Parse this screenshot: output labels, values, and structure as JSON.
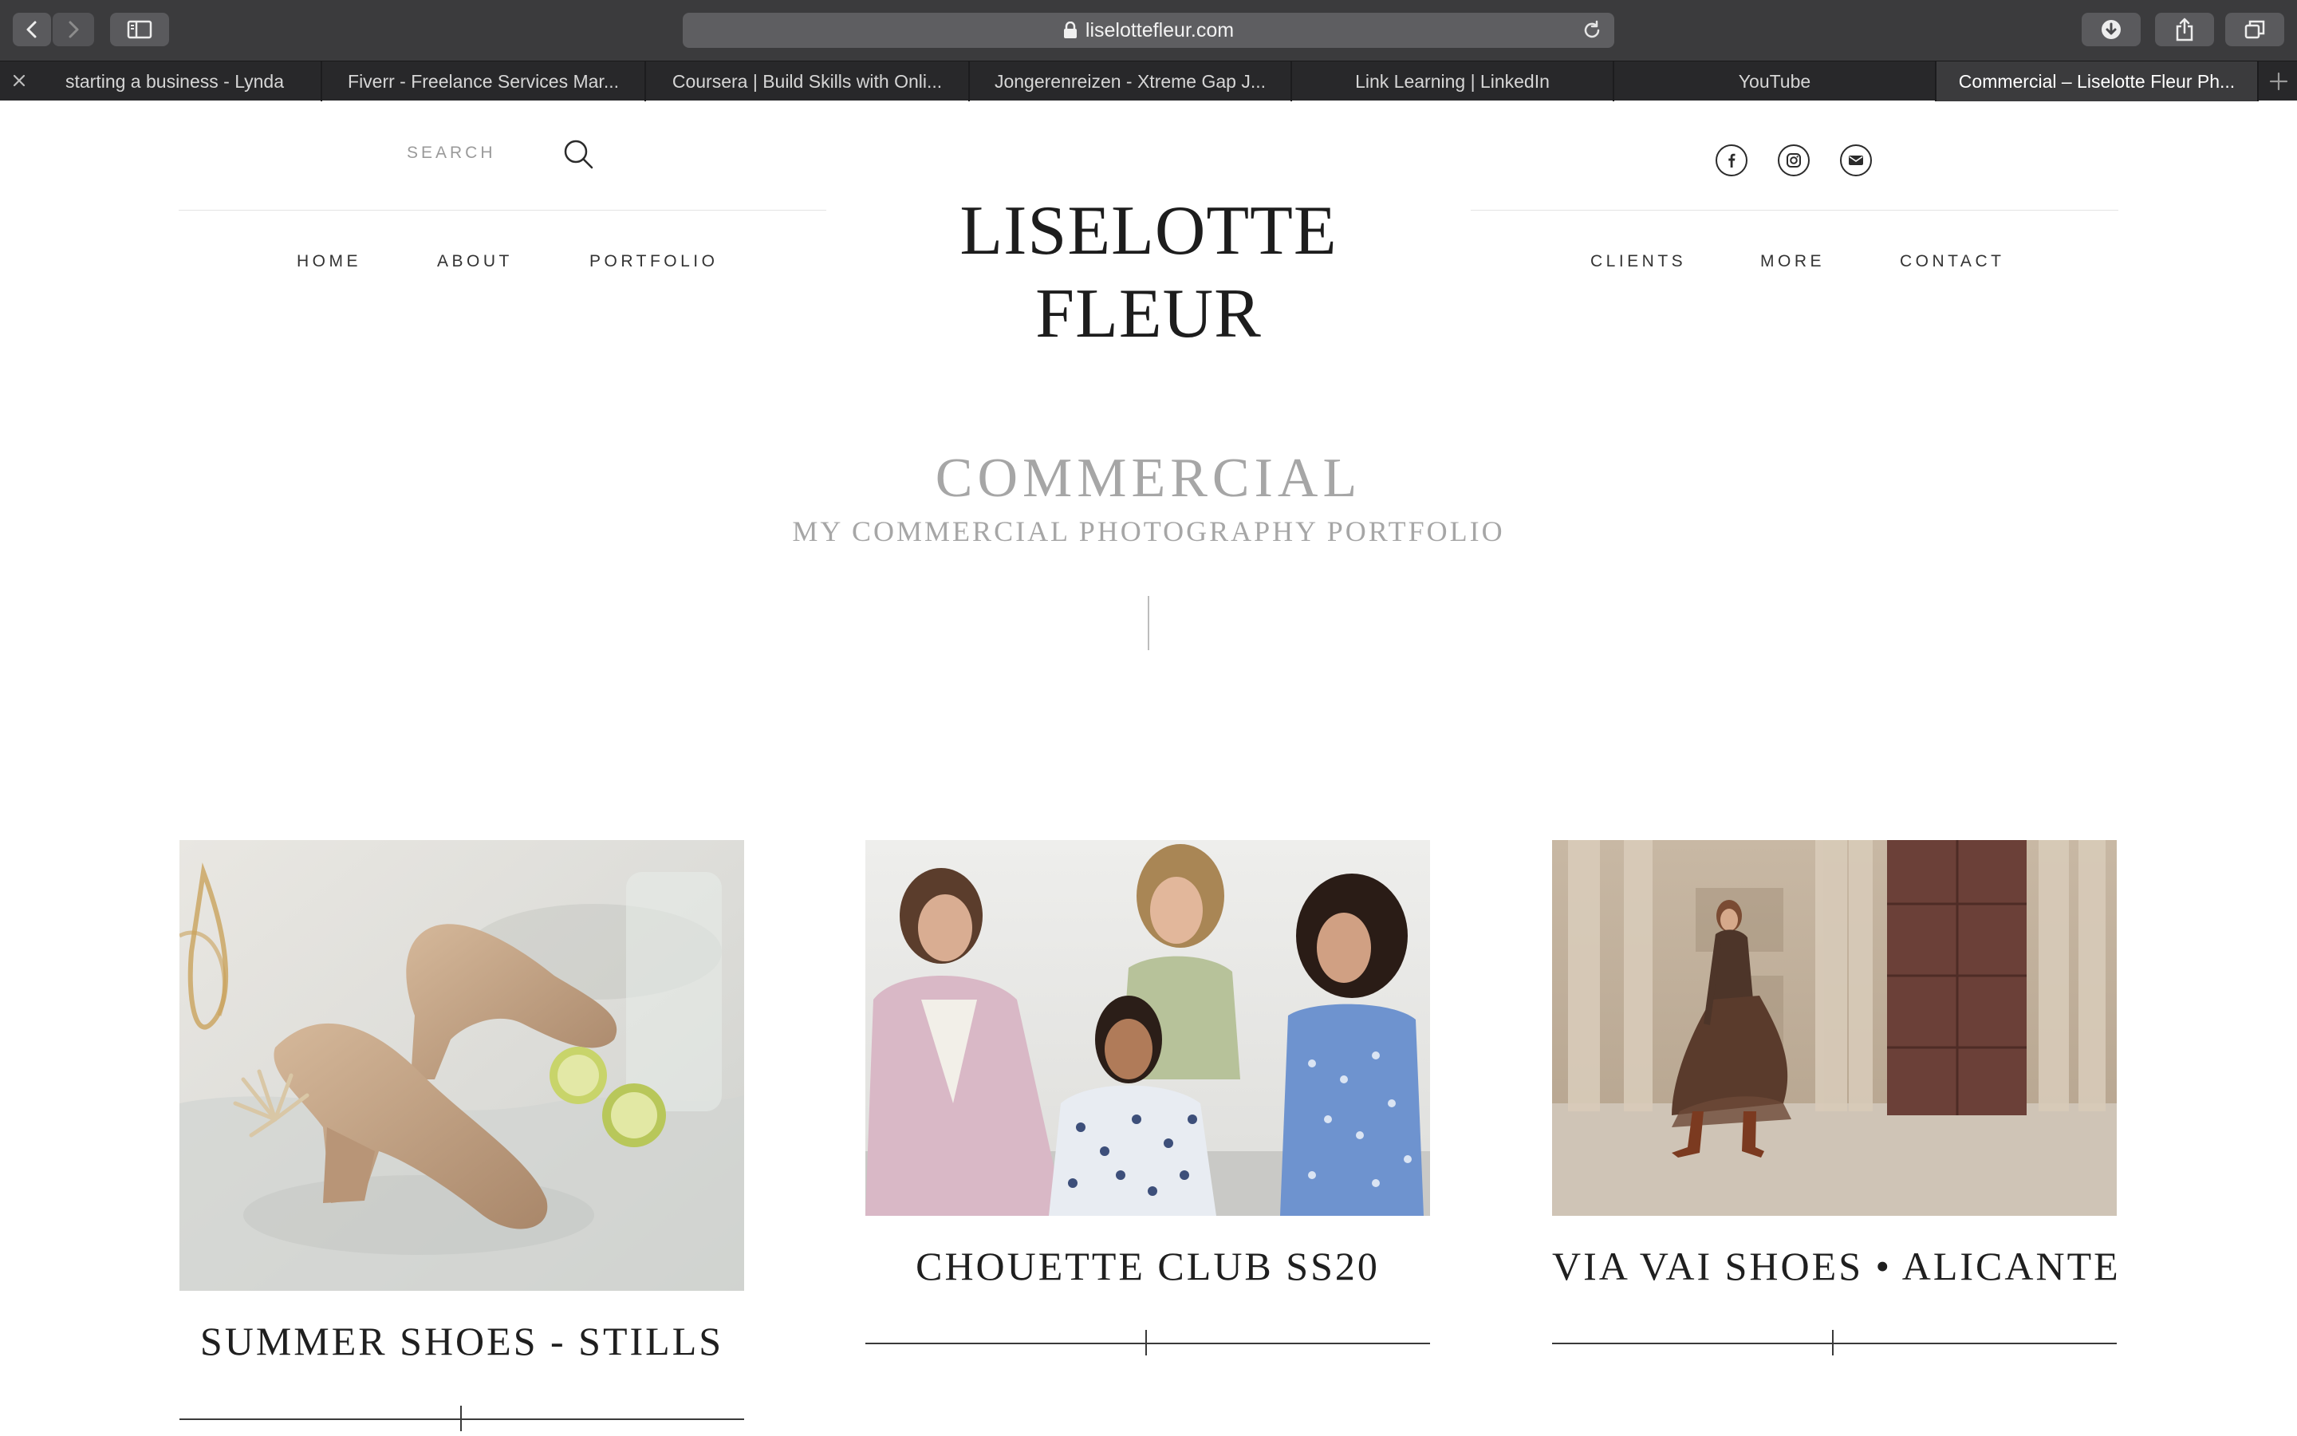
{
  "browser": {
    "url": "liselottefleur.com",
    "tabs": [
      "starting a business - Lynda",
      "Fiverr - Freelance Services Mar...",
      "Coursera | Build Skills with Onli...",
      "Jongerenreizen - Xtreme Gap J...",
      "Link Learning | LinkedIn",
      "YouTube",
      "Commercial – Liselotte Fleur Ph..."
    ],
    "active_tab_index": 6,
    "icons": [
      "back-icon",
      "forward-icon",
      "sidebar-icon",
      "lock-icon",
      "reload-icon",
      "download-icon",
      "share-icon",
      "tabs-overview-icon",
      "close-icon",
      "new-tab-icon"
    ]
  },
  "site": {
    "search_label": "SEARCH",
    "logo": "LISELOTTE FLEUR",
    "nav_left": [
      "HOME",
      "ABOUT",
      "PORTFOLIO"
    ],
    "nav_right": [
      "CLIENTS",
      "MORE",
      "CONTACT"
    ],
    "social_icons": [
      "facebook-icon",
      "instagram-icon",
      "email-icon"
    ]
  },
  "hero": {
    "title": "COMMERCIAL",
    "subtitle": "MY COMMERCIAL PHOTOGRAPHY PORTFOLIO"
  },
  "portfolio": [
    {
      "title": "SUMMER SHOES - STILLS"
    },
    {
      "title": "CHOUETTE CLUB SS20"
    },
    {
      "title": "VIA VAI SHOES • ALICANTE"
    }
  ],
  "colors": {
    "chrome_toolbar": "#3b3b3d",
    "tab_bar": "#28282a",
    "active_tab": "#3b3b3d",
    "hero_text": "#a6a6a6",
    "logo_text": "#1d1d1d"
  }
}
